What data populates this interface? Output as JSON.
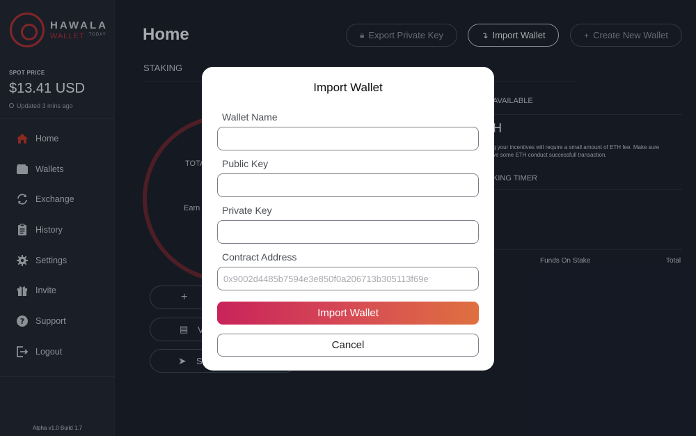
{
  "app": {
    "logo_name": "HAWALA",
    "logo_sub": "WALLET",
    "logo_tag": "TODAY"
  },
  "sidebar": {
    "spot_label": "SPOT PRICE",
    "spot_price": "$13.41 USD",
    "updated": "Updated 3 mins ago",
    "items": [
      {
        "label": "Home",
        "icon": "home-icon"
      },
      {
        "label": "Wallets",
        "icon": "wallet-icon"
      },
      {
        "label": "Exchange",
        "icon": "exchange-icon"
      },
      {
        "label": "History",
        "icon": "history-icon"
      },
      {
        "label": "Settings",
        "icon": "gear-icon"
      },
      {
        "label": "Invite",
        "icon": "gift-icon"
      },
      {
        "label": "Support",
        "icon": "help-icon"
      },
      {
        "label": "Logout",
        "icon": "logout-icon"
      }
    ],
    "active_item": "Home",
    "version": "Alpha v1.0 Build 1.7"
  },
  "header": {
    "title": "Home",
    "export_label": "Export Private Key",
    "import_label": "Import Wallet",
    "create_label": "Create New Wallet"
  },
  "background": {
    "staking": "STAKING",
    "tot_partial": "TOTA",
    "earn_partial": "Earn",
    "btn2_partial": "V",
    "btn3_partial": "Se",
    "available": "AVAILABLE",
    "h_partial": "H",
    "note_line1": "g your incentives will require a small amount of ETH fee. Make sure",
    "note_line2": "ve some ETH conduct successfull transaction.",
    "timer": "KING TIMER",
    "funds_on_stake": "Funds On Stake",
    "total": "Total"
  },
  "modal": {
    "title": "Import Wallet",
    "wallet_name_label": "Wallet Name",
    "wallet_name_value": "",
    "public_key_label": "Public Key",
    "public_key_value": "",
    "private_key_label": "Private Key",
    "private_key_value": "",
    "contract_label": "Contract Address",
    "contract_placeholder": "0x9002d4485b7594e3e850f0a206713b305113f69e",
    "import_button": "Import Wallet",
    "cancel_button": "Cancel"
  },
  "colors": {
    "accent": "#b3343a",
    "gradient_start": "#c9235a",
    "gradient_end": "#df7040",
    "sidebar_bg": "#232a37",
    "main_bg": "#1c2330"
  }
}
